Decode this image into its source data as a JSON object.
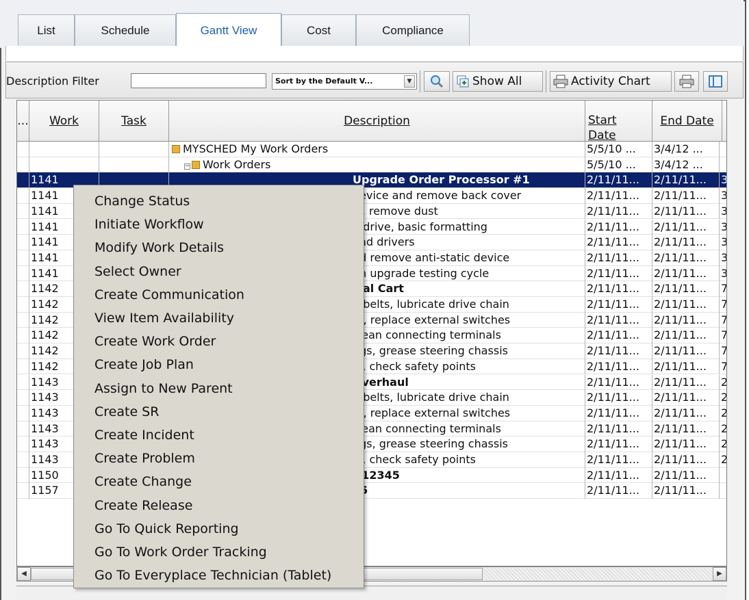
{
  "tabs": [
    {
      "label": "List"
    },
    {
      "label": "Schedule"
    },
    {
      "label": "Gantt View",
      "active": true
    },
    {
      "label": "Cost"
    },
    {
      "label": "Compliance"
    }
  ],
  "toolbar": {
    "filter_label": "Description Filter",
    "filter_value": "",
    "sort_value": "Sort by the Default V...",
    "show_all_label": "Show All",
    "activity_chart_label": "Activity Chart"
  },
  "grid": {
    "headers": {
      "col0": "...",
      "work": "Work",
      "task": "Task",
      "description": "Description",
      "start": "Start Date",
      "end": "End Date"
    },
    "rows": [
      {
        "work": "",
        "task": "",
        "desc": "MYSCHED  My Work Orders",
        "start": "5/5/10 ...",
        "end": "3/4/12 ...",
        "extra": "",
        "level": 0,
        "folder": true
      },
      {
        "work": "",
        "task": "",
        "desc": "Work Orders",
        "start": "5/5/10 ...",
        "end": "3/4/12 ...",
        "extra": "",
        "level": 1,
        "folder": true
      },
      {
        "work": "1141",
        "task": "",
        "desc": "Upgrade Order Processor #1",
        "start": "2/11/11...",
        "end": "2/11/11...",
        "extra": "3",
        "selected": true,
        "bold": true
      },
      {
        "work": "1141",
        "task": "",
        "desc": "device and remove back cover",
        "start": "2/11/11...",
        "end": "2/11/11...",
        "extra": "3"
      },
      {
        "work": "1141",
        "task": "",
        "desc": "M, remove dust",
        "start": "2/11/11...",
        "end": "2/11/11...",
        "extra": "3"
      },
      {
        "work": "1141",
        "task": "",
        "desc": "d drive, basic formatting",
        "start": "2/11/11...",
        "end": "2/11/11...",
        "extra": "3"
      },
      {
        "work": "1141",
        "task": "",
        "desc": "and drivers",
        "start": "2/11/11...",
        "end": "2/11/11...",
        "extra": "3"
      },
      {
        "work": "1141",
        "task": "",
        "desc": "nd remove anti-static device",
        "start": "2/11/11...",
        "end": "2/11/11...",
        "extra": "3"
      },
      {
        "work": "1141",
        "task": "",
        "desc": "gh upgrade testing cycle",
        "start": "2/11/11...",
        "end": "2/11/11...",
        "extra": "3"
      },
      {
        "work": "1142",
        "task": "",
        "desc": "ical Cart",
        "start": "2/11/11...",
        "end": "2/11/11...",
        "extra": "7",
        "bold": true
      },
      {
        "work": "1142",
        "task": "",
        "desc": "n belts, lubricate drive chain",
        "start": "2/11/11...",
        "end": "2/11/11...",
        "extra": "7"
      },
      {
        "work": "1142",
        "task": "",
        "desc": "m, replace external switches",
        "start": "2/11/11...",
        "end": "2/11/11...",
        "extra": "7"
      },
      {
        "work": "1142",
        "task": "",
        "desc": " clean connecting terminals",
        "start": "2/11/11...",
        "end": "2/11/11...",
        "extra": "7"
      },
      {
        "work": "1142",
        "task": "",
        "desc": "ngs, grease steering chassis",
        "start": "2/11/11...",
        "end": "2/11/11...",
        "extra": "7"
      },
      {
        "work": "1142",
        "task": "",
        "desc": "le, check safety points",
        "start": "2/11/11...",
        "end": "2/11/11...",
        "extra": "7"
      },
      {
        "work": "1143",
        "task": "",
        "desc": " Overhaul",
        "start": "2/11/11...",
        "end": "2/11/11...",
        "extra": "2",
        "bold": true
      },
      {
        "work": "1143",
        "task": "",
        "desc": "n belts, lubricate drive chain",
        "start": "2/11/11...",
        "end": "2/11/11...",
        "extra": "2"
      },
      {
        "work": "1143",
        "task": "",
        "desc": "m, replace external switches",
        "start": "2/11/11...",
        "end": "2/11/11...",
        "extra": "2"
      },
      {
        "work": "1143",
        "task": "",
        "desc": " clean connecting terminals",
        "start": "2/11/11...",
        "end": "2/11/11...",
        "extra": "2"
      },
      {
        "work": "1143",
        "task": "",
        "desc": "ngs, grease steering chassis",
        "start": "2/11/11...",
        "end": "2/11/11...",
        "extra": "2"
      },
      {
        "work": "1143",
        "task": "",
        "desc": "le, check safety points",
        "start": "2/11/11...",
        "end": "2/11/11...",
        "extra": "2"
      },
      {
        "work": "1150",
        "task": "",
        "desc": "t 12345",
        "start": "2/11/11...",
        "end": "2/11/11...",
        "extra": "",
        "bold": true
      },
      {
        "work": "1157",
        "task": "",
        "desc": "15",
        "start": "2/11/11...",
        "end": "2/11/11...",
        "extra": "",
        "bold": true
      }
    ]
  },
  "context_menu": {
    "items": [
      "Change Status",
      "Initiate Workflow",
      "Modify Work Details",
      "Select Owner",
      "Create Communication",
      "View Item Availability",
      "Create Work Order",
      "Create Job Plan",
      "Assign to New Parent",
      "Create SR",
      "Create Incident",
      "Create Problem",
      "Create Change",
      "Create Release",
      "Go To Quick Reporting",
      "Go To Work Order Tracking",
      "Go To Everyplace Technician (Tablet)"
    ]
  }
}
